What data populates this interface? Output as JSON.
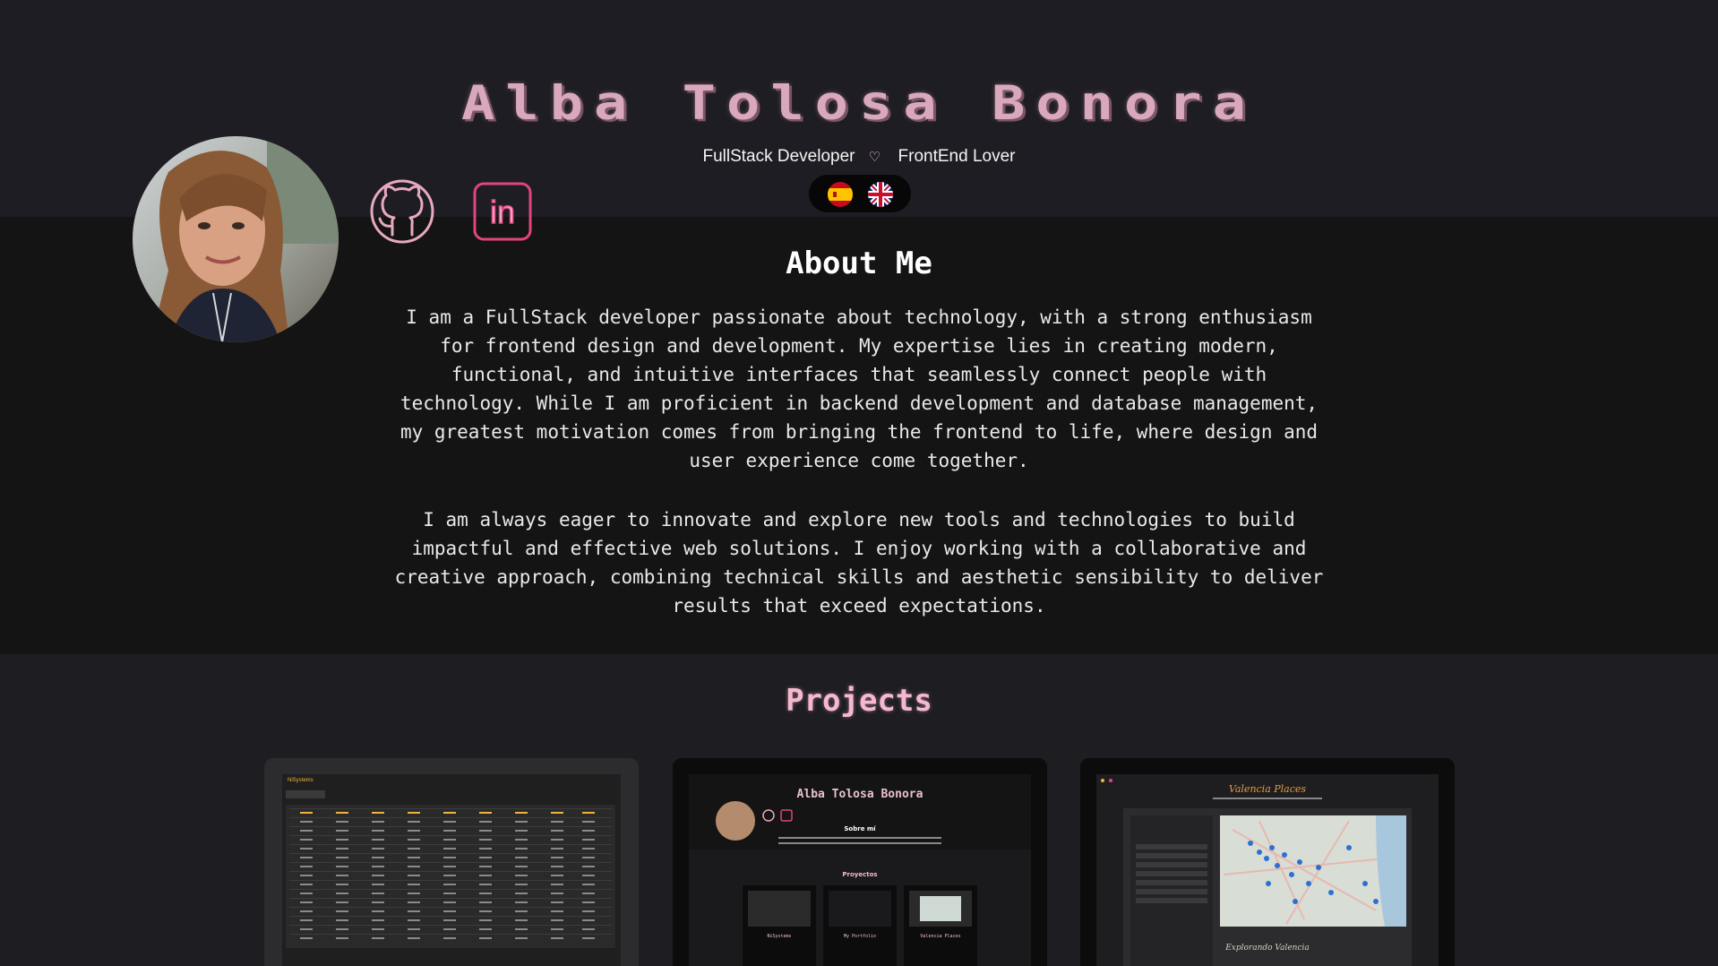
{
  "header": {
    "name": "Alba Tolosa Bonora",
    "role": "FullStack Developer",
    "heart": "♡",
    "passion": "FrontEnd Lover",
    "languages": [
      "es-flag",
      "uk-flag"
    ]
  },
  "social": {
    "github_icon": "github-icon",
    "linkedin_icon": "linkedin-icon",
    "linkedin_text": "in"
  },
  "about": {
    "title": "About Me",
    "p1": "I am a FullStack developer passionate about technology, with a strong enthusiasm for frontend design and development. My expertise lies in creating modern, functional, and intuitive interfaces that seamlessly connect people with technology. While I am proficient in backend development and database management, my greatest motivation comes from bringing the frontend to life, where design and user experience come together.",
    "p2": "I am always eager to innovate and explore new tools and technologies to build impactful and effective web solutions. I enjoy working with a collaborative and creative approach, combining technical skills and aesthetic sensibility to deliver results that exceed expectations."
  },
  "projects": {
    "title": "Projects",
    "items": [
      {
        "title": "NiSystems"
      },
      {
        "title": "Alba Tolosa Bonora",
        "section_about": "Sobre mí",
        "section_projects": "Proyectos",
        "thumbs": [
          "NiSystems",
          "My Portfolio",
          "Valencia Places"
        ]
      },
      {
        "title": "Valencia Places",
        "footer": "Explorando Valencia"
      }
    ]
  },
  "colors": {
    "accent_pink": "#d9a8bd",
    "linkedin_pink": "#e0457f",
    "github_outline": "#e7a9c0",
    "background": "#1d1d22",
    "about_background": "#141414"
  }
}
